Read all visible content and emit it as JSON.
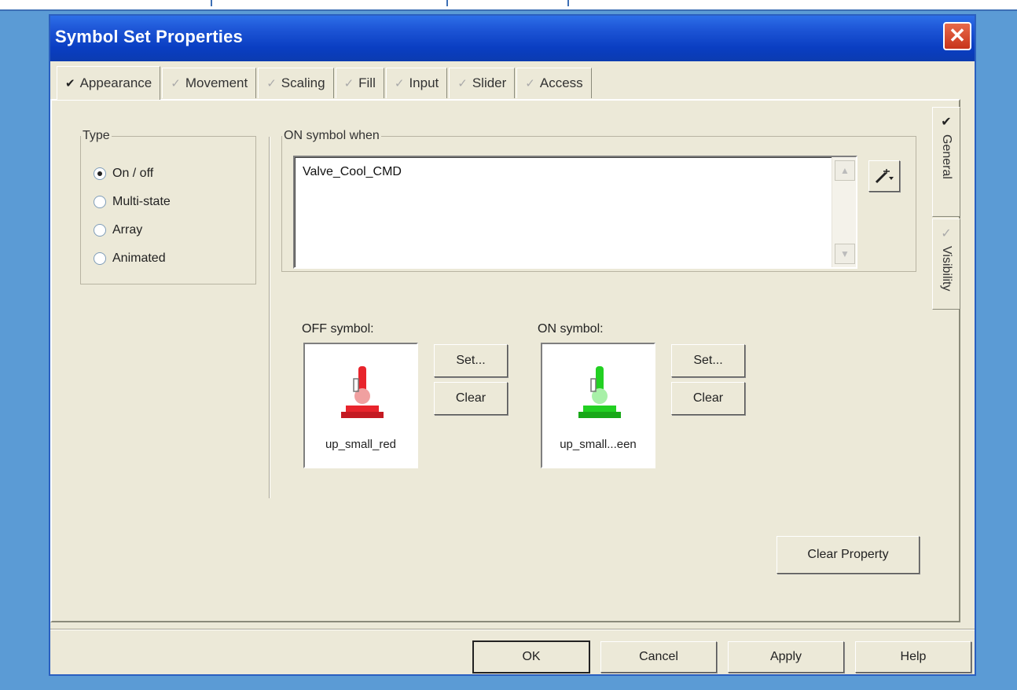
{
  "dialog": {
    "title": "Symbol Set Properties",
    "close_icon": "close-icon",
    "accent_color": "#0a3ec2"
  },
  "tabs": [
    {
      "label": "Appearance",
      "active": true
    },
    {
      "label": "Movement",
      "active": false
    },
    {
      "label": "Scaling",
      "active": false
    },
    {
      "label": "Fill",
      "active": false
    },
    {
      "label": "Input",
      "active": false
    },
    {
      "label": "Slider",
      "active": false
    },
    {
      "label": "Access",
      "active": false
    }
  ],
  "side_tabs": [
    {
      "label": "General",
      "active": true
    },
    {
      "label": "Visibility",
      "active": false
    }
  ],
  "type_group": {
    "legend": "Type",
    "options": [
      {
        "label": "On / off",
        "selected": true
      },
      {
        "label": "Multi-state",
        "selected": false
      },
      {
        "label": "Array",
        "selected": false
      },
      {
        "label": "Animated",
        "selected": false
      }
    ]
  },
  "on_when": {
    "legend": "ON symbol when",
    "value": "Valve_Cool_CMD"
  },
  "off_symbol": {
    "label": "OFF symbol:",
    "name": "up_small_red",
    "color": "#e8242c",
    "set_label": "Set...",
    "clear_label": "Clear"
  },
  "on_symbol": {
    "label": "ON symbol:",
    "name": "up_small...een",
    "color": "#22d022",
    "set_label": "Set...",
    "clear_label": "Clear"
  },
  "clear_property_label": "Clear Property",
  "footer": {
    "ok": "OK",
    "cancel": "Cancel",
    "apply": "Apply",
    "help": "Help"
  }
}
